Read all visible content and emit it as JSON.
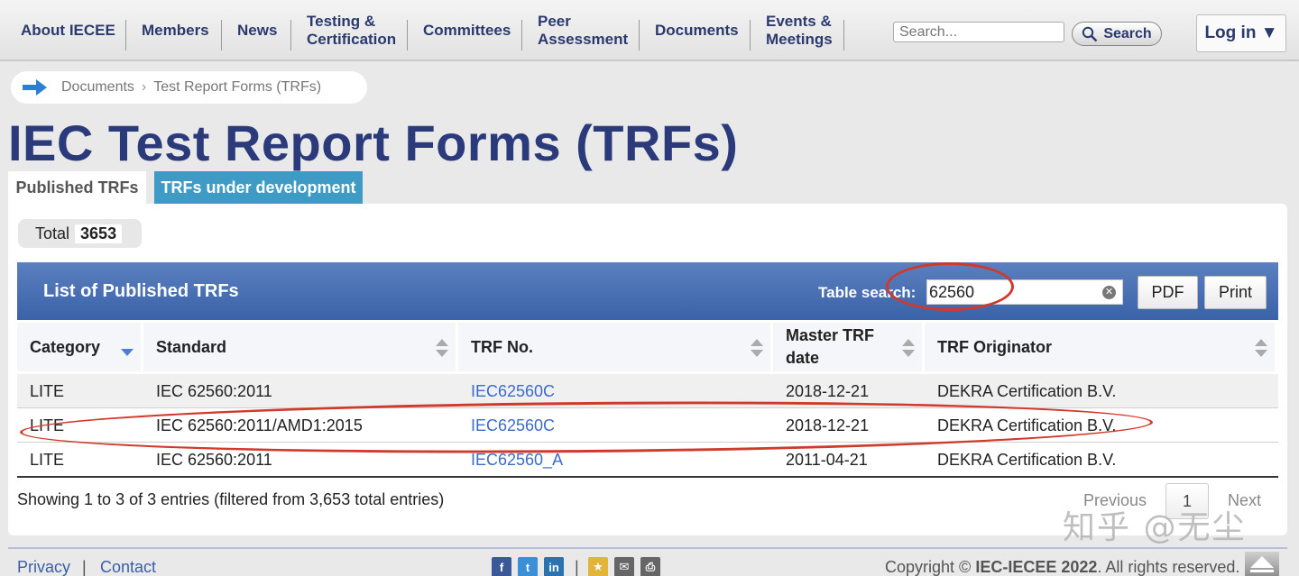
{
  "nav": {
    "items": [
      "About IECEE",
      "Members",
      "News",
      "Testing &\nCertification",
      "Committees",
      "Peer\nAssessment",
      "Documents",
      "Events &\nMeetings"
    ],
    "search_placeholder": "Search...",
    "search_button": "Search",
    "login": "Log in ▼"
  },
  "breadcrumb": {
    "root": "Documents",
    "current": "Test Report Forms (TRFs)"
  },
  "title": "IEC Test Report Forms (TRFs)",
  "tabs": {
    "published": "Published TRFs",
    "development": "TRFs under development"
  },
  "total": {
    "label": "Total",
    "value": "3653"
  },
  "list": {
    "title": "List of Published TRFs",
    "search_label": "Table search:",
    "search_value": "62560",
    "pdf": "PDF",
    "print": "Print"
  },
  "table": {
    "headers": [
      "Category",
      "Standard",
      "TRF No.",
      "Master TRF date",
      "TRF Originator"
    ],
    "rows": [
      [
        "LITE",
        "IEC 62560:2011",
        "IEC62560C",
        "2018-12-21",
        "DEKRA Certification B.V."
      ],
      [
        "LITE",
        "IEC 62560:2011/AMD1:2015",
        "IEC62560C",
        "2018-12-21",
        "DEKRA Certification B.V."
      ],
      [
        "LITE",
        "IEC 62560:2011",
        "IEC62560_A",
        "2011-04-21",
        "DEKRA Certification B.V."
      ]
    ]
  },
  "entries_info": "Showing 1 to 3 of 3 entries (filtered from 3,653 total entries)",
  "pager": {
    "previous": "Previous",
    "page": "1",
    "next": "Next"
  },
  "footer": {
    "privacy": "Privacy",
    "sep": "|",
    "contact": "Contact",
    "copyright_pre": "Copyright © ",
    "copyright_org": "IEC-IECEE 2022",
    "copyright_post": ". All rights reserved."
  },
  "watermark": "知乎 @无尘",
  "colors": {
    "accent": "#2b3a7a",
    "header_bar": "#3a62a8",
    "tab_dev": "#3d9bc6",
    "link": "#3a6cc8",
    "annotation": "#d03a2a"
  }
}
